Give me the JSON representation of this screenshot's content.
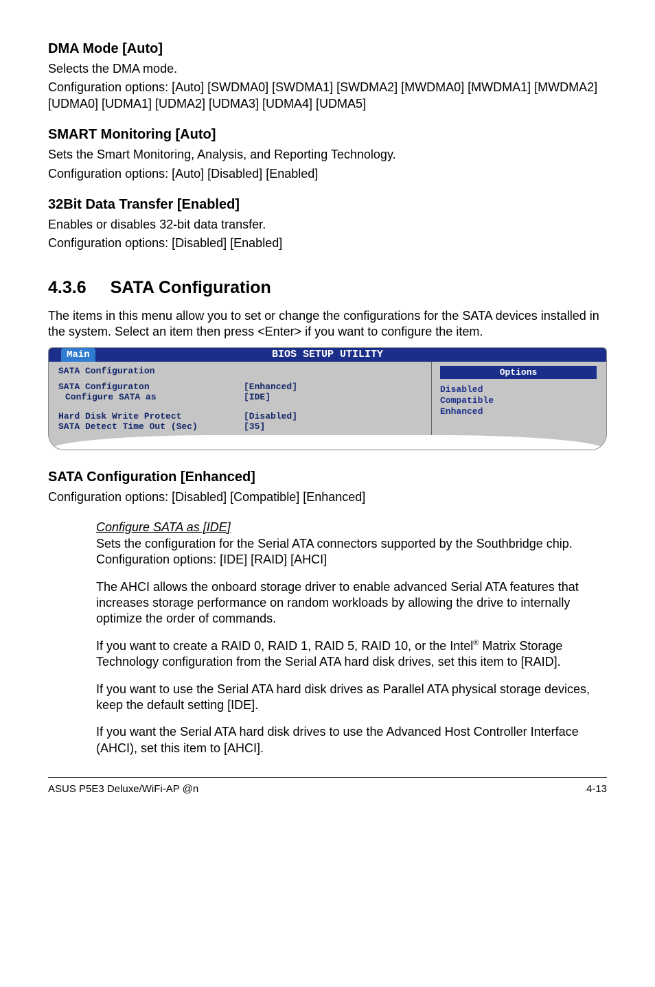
{
  "sections": {
    "dma": {
      "heading": "DMA Mode [Auto]",
      "p1": "Selects the DMA mode.",
      "p2": "Configuration options: [Auto] [SWDMA0] [SWDMA1] [SWDMA2] [MWDMA0] [MWDMA1] [MWDMA2] [UDMA0] [UDMA1] [UDMA2] [UDMA3] [UDMA4] [UDMA5]"
    },
    "smart": {
      "heading": "SMART Monitoring [Auto]",
      "p1": "Sets the Smart Monitoring, Analysis, and Reporting Technology.",
      "p2": "Configuration options: [Auto] [Disabled] [Enabled]"
    },
    "bit32": {
      "heading": "32Bit Data Transfer [Enabled]",
      "p1": "Enables or disables 32-bit data transfer.",
      "p2": "Configuration options: [Disabled] [Enabled]"
    },
    "sataTitle": {
      "num": "4.3.6",
      "text": "SATA Configuration"
    },
    "sataIntro": "The items in this menu allow you to set or change the configurations for the SATA devices installed in the system. Select an item then press <Enter> if you want to configure the item.",
    "sataConfigEnhanced": {
      "heading": "SATA Configuration [Enhanced]",
      "p1": "Configuration options: [Disabled] [Compatible] [Enhanced]"
    },
    "configureSata": {
      "title": "Configure SATA as [IDE]",
      "p1": "Sets the configuration for the Serial ATA connectors supported by the Southbridge chip. Configuration options: [IDE] [RAID] [AHCI]",
      "p2": "The AHCI allows the onboard storage driver to enable advanced Serial ATA features that increases storage performance on random workloads by allowing the drive to internally optimize the order of commands.",
      "p3a": "If you want to create a RAID 0, RAID 1, RAID 5, RAID 10, or the Intel",
      "p3b": " Matrix Storage Technology configuration from the Serial ATA hard disk drives, set this item to [RAID].",
      "p4": "If you want to use the Serial ATA hard disk drives as Parallel ATA physical storage devices, keep the default setting [IDE].",
      "p5": "If you want the Serial ATA hard disk drives to use the Advanced Host Controller Interface (AHCI), set this item to [AHCI]."
    }
  },
  "bios": {
    "headerTitle": "BIOS SETUP UTILITY",
    "tab": "Main",
    "leftTitle": "SATA Configuration",
    "rows": {
      "r1label": "SATA Configuraton",
      "r1val": "[Enhanced]",
      "r2label": "Configure SATA as",
      "r2val": "[IDE]",
      "r3label": "Hard Disk Write Protect",
      "r3val": "[Disabled]",
      "r4label": "SATA Detect Time Out (Sec)",
      "r4val": "[35]"
    },
    "optionsTitle": "Options",
    "options": {
      "o1": "Disabled",
      "o2": "Compatible",
      "o3": "Enhanced"
    }
  },
  "footer": {
    "left": "ASUS P5E3 Deluxe/WiFi-AP @n",
    "right": "4-13"
  }
}
